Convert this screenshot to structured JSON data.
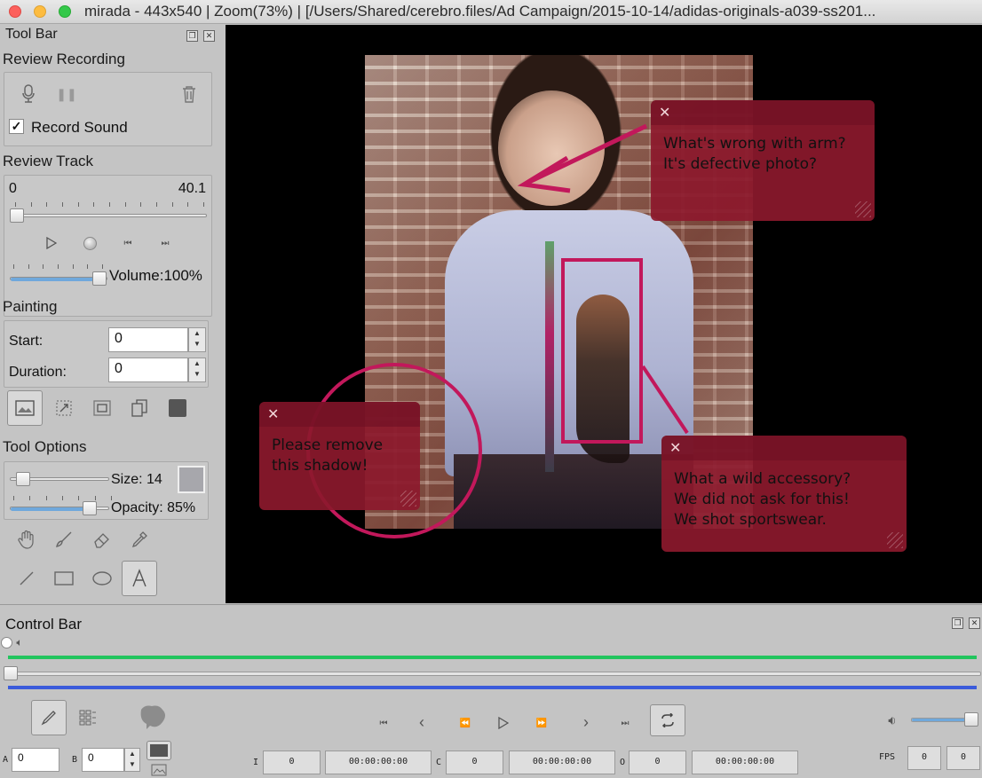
{
  "window": {
    "title": "mirada - 443x540 | Zoom(73%) | [/Users/Shared/cerebro.files/Ad Campaign/2015-10-14/adidas-originals-a039-ss201..."
  },
  "toolbar": {
    "title": "Tool Bar",
    "review_recording": {
      "heading": "Review Recording",
      "record_sound_label": "Record Sound",
      "record_sound_checked": true
    },
    "review_track": {
      "heading": "Review Track",
      "start_value": "0",
      "end_value": "40.1",
      "volume_label": "Volume:",
      "volume_value": "100%",
      "volume_level": 1.0,
      "position_level": 0.0
    },
    "painting": {
      "heading": "Painting",
      "start_label": "Start:",
      "start_value": "0",
      "duration_label": "Duration:",
      "duration_value": "0"
    },
    "tool_options": {
      "heading": "Tool Options",
      "size_label": "Size: 14",
      "opacity_label": "Opacity: 85%",
      "size_level": 0.1,
      "opacity_level": 0.85
    }
  },
  "annotations": [
    {
      "text_line1": "What's wrong with arm?",
      "text_line2": "It's defective photo?"
    },
    {
      "text_line1": "Please remove",
      "text_line2": "this shadow!"
    },
    {
      "text_line1": "What a wild accessory?",
      "text_line2": "We did not ask for this!",
      "text_line3": "We shot sportswear."
    }
  ],
  "controlbar": {
    "title": "Control Bar",
    "a_label": "A",
    "a_value": "0",
    "b_label": "B",
    "b_value": "0",
    "i_label": "I",
    "i_frame": "0",
    "i_time": "00:00:00:00",
    "c_label": "C",
    "c_frame": "0",
    "c_time": "00:00:00:00",
    "o_label": "O",
    "o_frame": "0",
    "o_time": "00:00:00:00",
    "fps_label": "FPS",
    "fps_value1": "0",
    "fps_value2": "0",
    "volume_level": 1.0
  },
  "colors": {
    "note_bg": "#8c192d",
    "markup": "#c2185b",
    "timeline_green": "#22c55e",
    "timeline_blue": "#3b5bdb"
  }
}
